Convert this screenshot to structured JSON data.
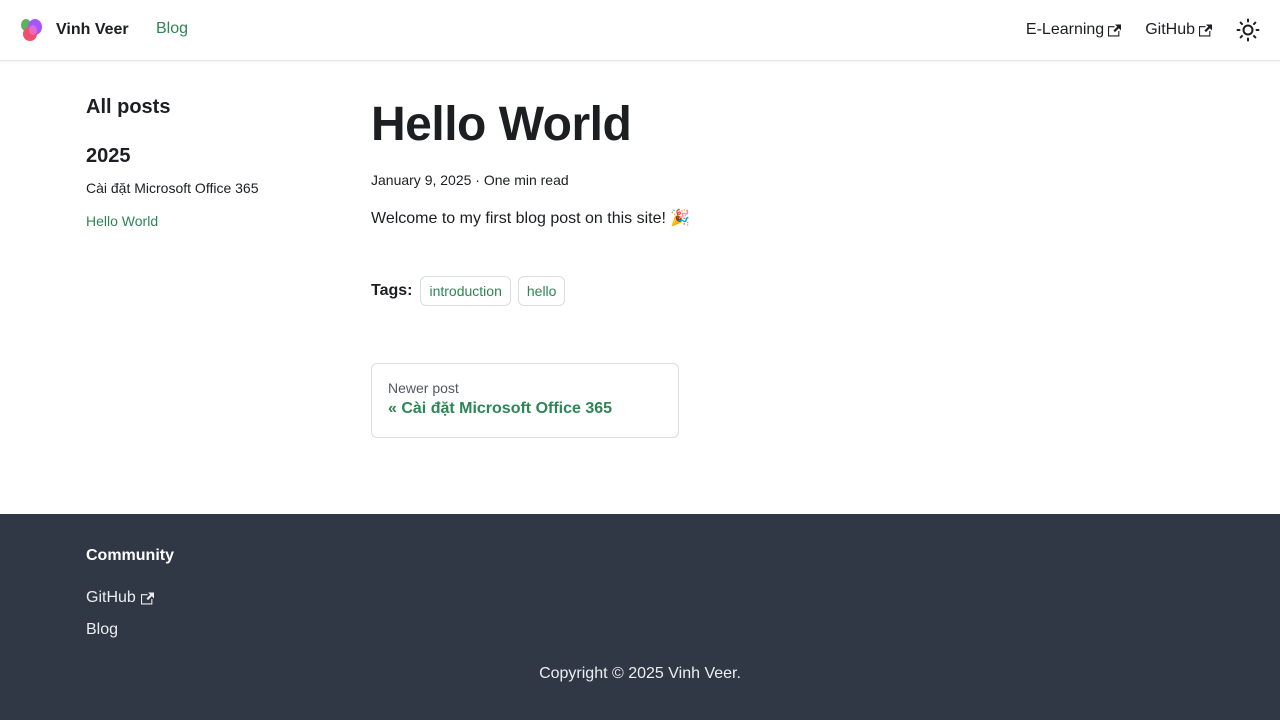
{
  "navbar": {
    "brand_title": "Vinh Veer",
    "blog_label": "Blog",
    "elearning_label": "E-Learning",
    "github_label": "GitHub",
    "theme_icon": "sun-icon",
    "accent_color": "#2e8555"
  },
  "sidebar": {
    "title": "All posts",
    "year": "2025",
    "items": [
      {
        "label": "Cài đặt Microsoft Office 365",
        "active": false
      },
      {
        "label": "Hello World",
        "active": true
      }
    ]
  },
  "post": {
    "title": "Hello World",
    "meta": "January 9, 2025 · One min read",
    "body": "Welcome to my first blog post on this site! 🎉",
    "tags_label": "Tags:",
    "tags": [
      "introduction",
      "hello"
    ],
    "pager_sub": "Newer post",
    "pager_label": "« Cài đặt Microsoft Office 365"
  },
  "footer": {
    "title": "Community",
    "links": [
      "GitHub",
      "Blog"
    ],
    "copyright": "Copyright © 2025 Vinh Veer.",
    "background": "#303846"
  }
}
